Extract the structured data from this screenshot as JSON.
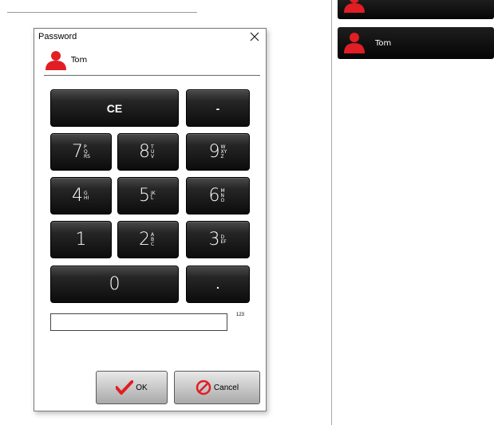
{
  "dialog": {
    "title": "Password",
    "user_name": "Tom",
    "ok_label": "OK",
    "cancel_label": "Cancel",
    "input_value": "",
    "input_counter": "123"
  },
  "keypad": {
    "clear": "CE",
    "minus": "-",
    "zero": "0",
    "dot": ".",
    "digits": [
      {
        "digit": "7",
        "letters": "PQRS"
      },
      {
        "digit": "8",
        "letters": "TUV"
      },
      {
        "digit": "9",
        "letters": "WXYZ"
      },
      {
        "digit": "4",
        "letters": "GHI"
      },
      {
        "digit": "5",
        "letters": "JKL"
      },
      {
        "digit": "6",
        "letters": "MNO"
      },
      {
        "digit": "1",
        "letters": ""
      },
      {
        "digit": "2",
        "letters": "ABC"
      },
      {
        "digit": "3",
        "letters": "DEF"
      }
    ]
  },
  "users": [
    {
      "name": "Tom"
    }
  ],
  "colors": {
    "accent_red": "#e01e24",
    "key_dark": "#111111"
  }
}
